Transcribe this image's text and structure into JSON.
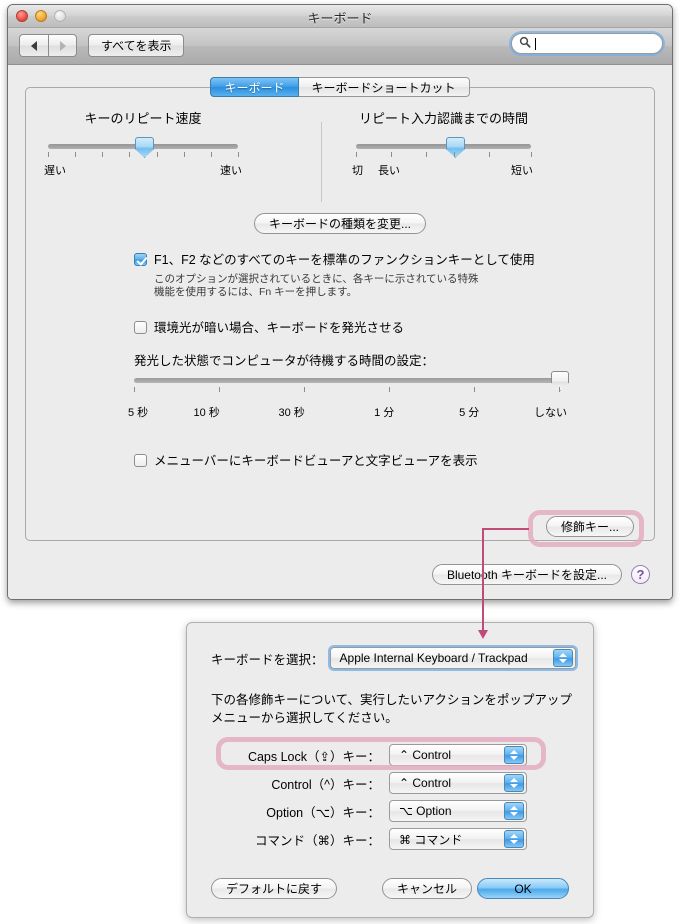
{
  "window": {
    "title": "キーボード",
    "traffic_lights": [
      "close-button",
      "minimize-button",
      "zoom-button"
    ],
    "toolbar": {
      "back_label": "◀",
      "forward_label": "▶",
      "show_all_label": "すべてを表示",
      "search_value": "",
      "search_placeholder": ""
    },
    "tabs": [
      {
        "label": "キーボード",
        "selected": true
      },
      {
        "label": "キーボードショートカット",
        "selected": false
      }
    ]
  },
  "keyboard_pane": {
    "repeat_rate": {
      "title": "キーのリピート速度",
      "min_label": "遅い",
      "max_label": "速い",
      "tick_count": 8,
      "value_index": 4
    },
    "delay_until_repeat": {
      "title": "リピート入力認識までの時間",
      "off_label": "切",
      "min_label": "長い",
      "max_label": "短い",
      "tick_count": 6,
      "value_index": 4
    },
    "change_keyboard_type_button": "キーボードの種類を変更...",
    "fkey_checkbox": {
      "label": "F1、F2 などのすべてのキーを標準のファンクションキーとして使用",
      "checked": true,
      "description_line1": "このオプションが選択されているときに、各キーに示されている特殊",
      "description_line2": "機能を使用するには、Fn キーを押します。"
    },
    "illumination_checkbox": {
      "label": "環境光が暗い場合、キーボードを発光させる",
      "checked": false
    },
    "illumination_slider": {
      "label": "発光した状態でコンピュータが待機する時間の設定：",
      "ticks": [
        "5 秒",
        "10 秒",
        "30 秒",
        "1 分",
        "5 分",
        "しない"
      ],
      "value_index": 5
    },
    "viewer_checkbox": {
      "label": "メニューバーにキーボードビューアと文字ビューアを表示",
      "checked": false
    },
    "modifier_keys_button": "修飾キー...",
    "bluetooth_button": "Bluetooth キーボードを設定...",
    "help_button": "?"
  },
  "modifier_dialog": {
    "select_keyboard_label": "キーボードを選択：",
    "selected_keyboard": "Apple Internal Keyboard / Trackpad",
    "description_line1": "下の各修飾キーについて、実行したいアクションをポップアップ",
    "description_line2": "メニューから選択してください。",
    "rows": [
      {
        "label": "Caps Lock（⇪）キー：",
        "value": "⌃ Control",
        "highlighted": true
      },
      {
        "label": "Control（^）キー：",
        "value": "⌃ Control",
        "highlighted": false
      },
      {
        "label": "Option（⌥）キー：",
        "value": "⌥ Option",
        "highlighted": false
      },
      {
        "label": "コマンド（⌘）キー：",
        "value": "⌘ コマンド",
        "highlighted": false
      }
    ],
    "restore_defaults_button": "デフォルトに戻す",
    "cancel_button": "キャンセル",
    "ok_button": "OK"
  },
  "annotations": {
    "highlight_color": "#e2aac0",
    "callout_color": "#c04a78",
    "targets": [
      "modifier-keys-button",
      "caps-lock-row"
    ]
  }
}
